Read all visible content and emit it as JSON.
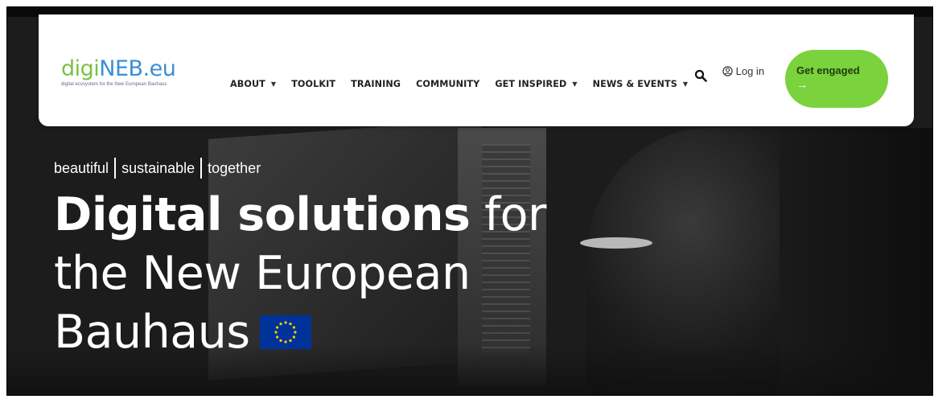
{
  "logo": {
    "part1": "digi",
    "part2": "NEB",
    "part3": ".eu",
    "subtitle": "digital ecosystem for the New European Bauhaus"
  },
  "nav": {
    "items": [
      {
        "label": "ABOUT",
        "has_dropdown": true
      },
      {
        "label": "TOOLKIT",
        "has_dropdown": false
      },
      {
        "label": "TRAINING",
        "has_dropdown": false
      },
      {
        "label": "COMMUNITY",
        "has_dropdown": false
      },
      {
        "label": "GET INSPIRED",
        "has_dropdown": true
      },
      {
        "label": "NEWS & EVENTS",
        "has_dropdown": true
      }
    ]
  },
  "header": {
    "search_icon": "search-icon",
    "login_label": "Log in",
    "cta_label": "Get engaged",
    "cta_arrow": "→"
  },
  "hero": {
    "tagline": [
      "beautiful",
      "sustainable",
      "together"
    ],
    "headline_bold": "Digital solutions",
    "headline_rest_1": " for",
    "headline_line2": "the New European",
    "headline_line3": "Bauhaus",
    "flag_icon": "eu-flag-icon"
  },
  "colors": {
    "logo_green": "#7ac143",
    "logo_blue": "#3a8fd6",
    "cta_green": "#7ad23c",
    "eu_blue": "#003399"
  }
}
